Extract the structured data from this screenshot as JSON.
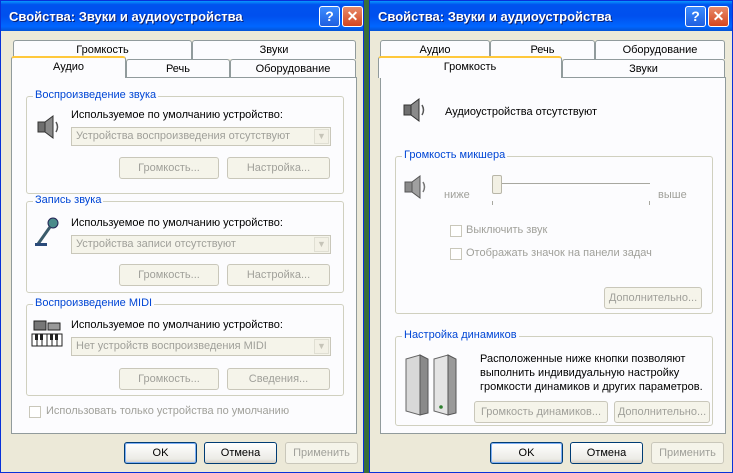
{
  "left_dialog": {
    "title": "Свойства: Звуки и аудиоустройства",
    "tabs_back": [
      "Громкость",
      "Звуки"
    ],
    "tabs_front": [
      "Аудио",
      "Речь",
      "Оборудование"
    ],
    "playback": {
      "group_label": "Воспроизведение звука",
      "default_label": "Используемое по умолчанию устройство:",
      "combo_value": "Устройства воспроизведения отсутствуют",
      "btn_volume": "Громкость...",
      "btn_settings": "Настройка..."
    },
    "recording": {
      "group_label": "Запись звука",
      "default_label": "Используемое по умолчанию устройство:",
      "combo_value": "Устройства записи отсутствуют",
      "btn_volume": "Громкость...",
      "btn_settings": "Настройка..."
    },
    "midi": {
      "group_label": "Воспроизведение MIDI",
      "default_label": "Используемое по умолчанию устройство:",
      "combo_value": "Нет устройств воспроизведения MIDI",
      "btn_volume": "Громкость...",
      "btn_about": "Сведения..."
    },
    "only_default_label": "Использовать только устройства по умолчанию",
    "ok": "OK",
    "cancel": "Отмена",
    "apply": "Применить"
  },
  "right_dialog": {
    "title": "Свойства: Звуки и аудиоустройства",
    "tabs_back": [
      "Аудио",
      "Речь",
      "Оборудование"
    ],
    "tabs_front": [
      "Громкость",
      "Звуки"
    ],
    "no_devices": "Аудиоустройства отсутствуют",
    "mixer": {
      "group_label": "Громкость микшера",
      "low": "ниже",
      "high": "выше",
      "level": 0,
      "mute_label": "Выключить звук",
      "tray_label": "Отображать значок на панели задач",
      "btn_advanced": "Дополнительно..."
    },
    "speakers": {
      "group_label": "Настройка динамиков",
      "description_line1": "Расположенные ниже кнопки позволяют",
      "description_line2": "выполнить индивидуальную настройку",
      "description_line3": "громкости динамиков и других параметров.",
      "btn_speaker_volume": "Громкость динамиков...",
      "btn_advanced": "Дополнительно..."
    },
    "ok": "OK",
    "cancel": "Отмена",
    "apply": "Применить"
  },
  "icons": {
    "help": "question-mark",
    "close": "x",
    "speaker": "speaker",
    "microphone": "microphone",
    "midi": "keyboard",
    "desktop_speakers": "speakers",
    "combo_arrow": "chevron-down"
  }
}
